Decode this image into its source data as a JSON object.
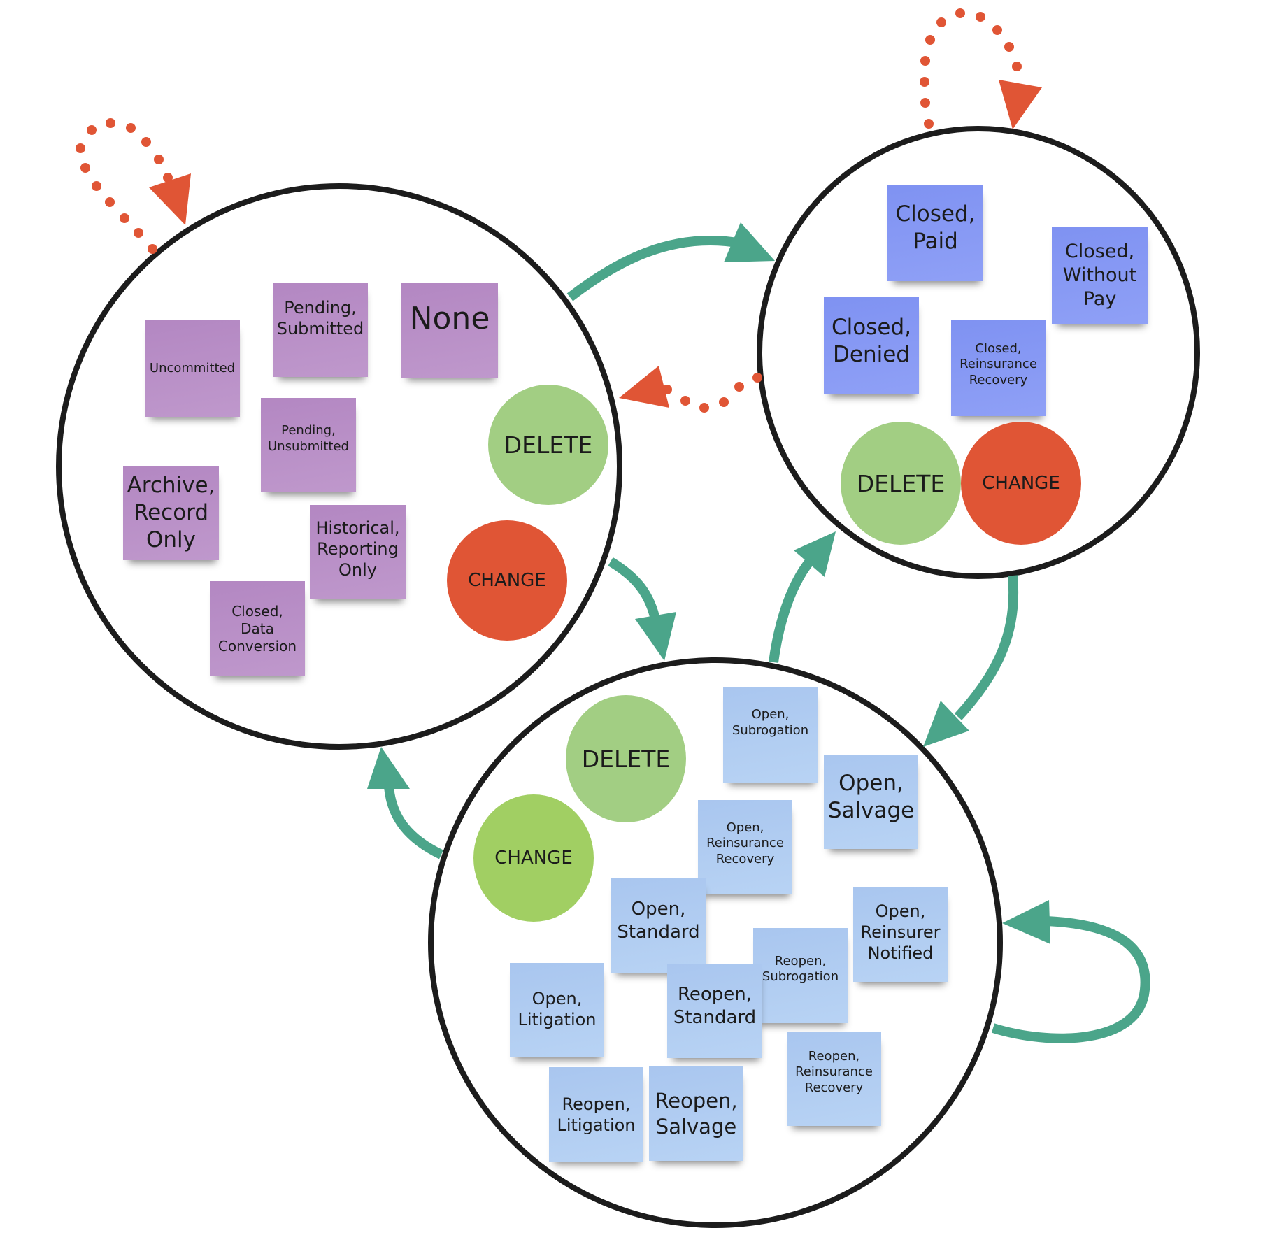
{
  "colors": {
    "ring": "#1c1c1c",
    "transition_arrow": "#4ba58a",
    "dotted_arrow": "#e05535",
    "delete_action": "#a2ce83",
    "change_action_red": "#e05535",
    "change_action_green": "#a1cf63",
    "sticky_purple": "#b88bc4",
    "sticky_indigo": "#8798f4",
    "sticky_sky": "#afcbf1"
  },
  "groups": {
    "pending_group": {
      "stickies": [
        {
          "label": "Uncommitted"
        },
        {
          "label": "Pending,\nSubmitted"
        },
        {
          "label": "None"
        },
        {
          "label": "Pending,\nUnsubmitted"
        },
        {
          "label": "Archive,\nRecord\nOnly"
        },
        {
          "label": "Historical,\nReporting\nOnly"
        },
        {
          "label": "Closed,\nData\nConversion"
        }
      ],
      "actions": {
        "delete": "DELETE",
        "change": "CHANGE"
      }
    },
    "closed_group": {
      "stickies": [
        {
          "label": "Closed,\nPaid"
        },
        {
          "label": "Closed,\nWithout\nPay"
        },
        {
          "label": "Closed,\nDenied"
        },
        {
          "label": "Closed,\nReinsurance\nRecovery"
        }
      ],
      "actions": {
        "delete": "DELETE",
        "change": "CHANGE"
      }
    },
    "open_group": {
      "stickies": [
        {
          "label": "Open,\nSubrogation"
        },
        {
          "label": "Open,\nSalvage"
        },
        {
          "label": "Open,\nReinsurance\nRecovery"
        },
        {
          "label": "Open,\nStandard"
        },
        {
          "label": "Open,\nReinsurer\nNotified"
        },
        {
          "label": "Reopen,\nSubrogation"
        },
        {
          "label": "Reopen,\nStandard"
        },
        {
          "label": "Open,\nLitigation"
        },
        {
          "label": "Reopen,\nReinsurance\nRecovery"
        },
        {
          "label": "Reopen,\nLitigation"
        },
        {
          "label": "Reopen,\nSalvage"
        }
      ],
      "actions": {
        "delete": "DELETE",
        "change": "CHANGE"
      }
    }
  },
  "transitions": [
    {
      "from": "pending_group",
      "to": "closed_group",
      "style": "solid"
    },
    {
      "from": "closed_group",
      "to": "pending_group",
      "style": "dotted"
    },
    {
      "from": "pending_group",
      "to": "open_group",
      "style": "solid"
    },
    {
      "from": "open_group",
      "to": "pending_group",
      "style": "solid"
    },
    {
      "from": "open_group",
      "to": "closed_group",
      "style": "solid"
    },
    {
      "from": "closed_group",
      "to": "open_group",
      "style": "solid"
    },
    {
      "from": "pending_group",
      "to": "pending_group",
      "style": "dotted"
    },
    {
      "from": "closed_group",
      "to": "closed_group",
      "style": "dotted"
    },
    {
      "from": "open_group",
      "to": "open_group",
      "style": "solid"
    }
  ]
}
